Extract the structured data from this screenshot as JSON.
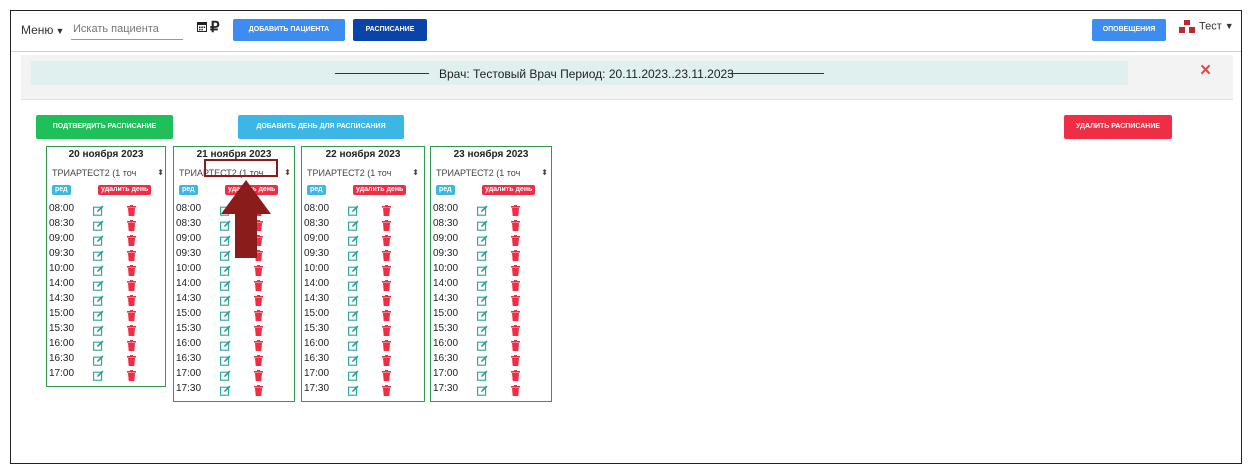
{
  "topbar": {
    "menu_label": "Меню",
    "search_placeholder": "Искать пациента",
    "currency_symbol": "₽",
    "add_patient_label": "ДОБАВИТЬ ПАЦИЕНТА",
    "schedule_label": "РАСПИСАНИЕ",
    "notifications_label": "ОПОВЕЩЕНИЯ",
    "user_label": "Тест"
  },
  "modal": {
    "title": "Врач: Тестовый Врач Период: 20.11.2023..23.11.2023",
    "close_symbol": "×",
    "confirm_label": "ПОДТВЕРДИТЬ РАСПИСАНИЕ",
    "add_day_label": "ДОБАВИТЬ ДЕНЬ ДЛЯ РАСПИСАНИЯ",
    "delete_schedule_label": "УДАЛИТЬ РАСПИСАНИЕ"
  },
  "days": [
    {
      "date": "20 ноября 2023",
      "select": "ТРИАРТЕСТ2 (1 точ",
      "edit_tag": "ред",
      "delete_tag": "удалить день",
      "times": [
        "08:00",
        "08:30",
        "09:00",
        "09:30",
        "10:00",
        "14:00",
        "14:30",
        "15:00",
        "15:30",
        "16:00",
        "16:30",
        "17:00"
      ]
    },
    {
      "date": "21 ноября 2023",
      "select": "ТРИАРТЕСТ2 (1 точ",
      "edit_tag": "ред",
      "delete_tag": "удалить день",
      "times": [
        "08:00",
        "08:30",
        "09:00",
        "09:30",
        "10:00",
        "14:00",
        "14:30",
        "15:00",
        "15:30",
        "16:00",
        "16:30",
        "17:00",
        "17:30"
      ]
    },
    {
      "date": "22 ноября 2023",
      "select": "ТРИАРТЕСТ2 (1 точ",
      "edit_tag": "ред",
      "delete_tag": "удалить день",
      "times": [
        "08:00",
        "08:30",
        "09:00",
        "09:30",
        "10:00",
        "14:00",
        "14:30",
        "15:00",
        "15:30",
        "16:00",
        "16:30",
        "17:00",
        "17:30"
      ]
    },
    {
      "date": "23 ноября 2023",
      "select": "ТРИАРТЕСТ2 (1 точ",
      "edit_tag": "ред",
      "delete_tag": "удалить день",
      "times": [
        "08:00",
        "08:30",
        "09:00",
        "09:30",
        "10:00",
        "14:00",
        "14:30",
        "15:00",
        "15:30",
        "16:00",
        "16:30",
        "17:00",
        "17:30"
      ]
    }
  ],
  "colors": {
    "primary": "#3d8cf0",
    "dark_primary": "#0a44aa",
    "success": "#1fbf5a",
    "info": "#3bb6e5",
    "danger": "#ef2e45",
    "edit_icon": "#2aa198",
    "annotation": "#8b1c1c"
  }
}
